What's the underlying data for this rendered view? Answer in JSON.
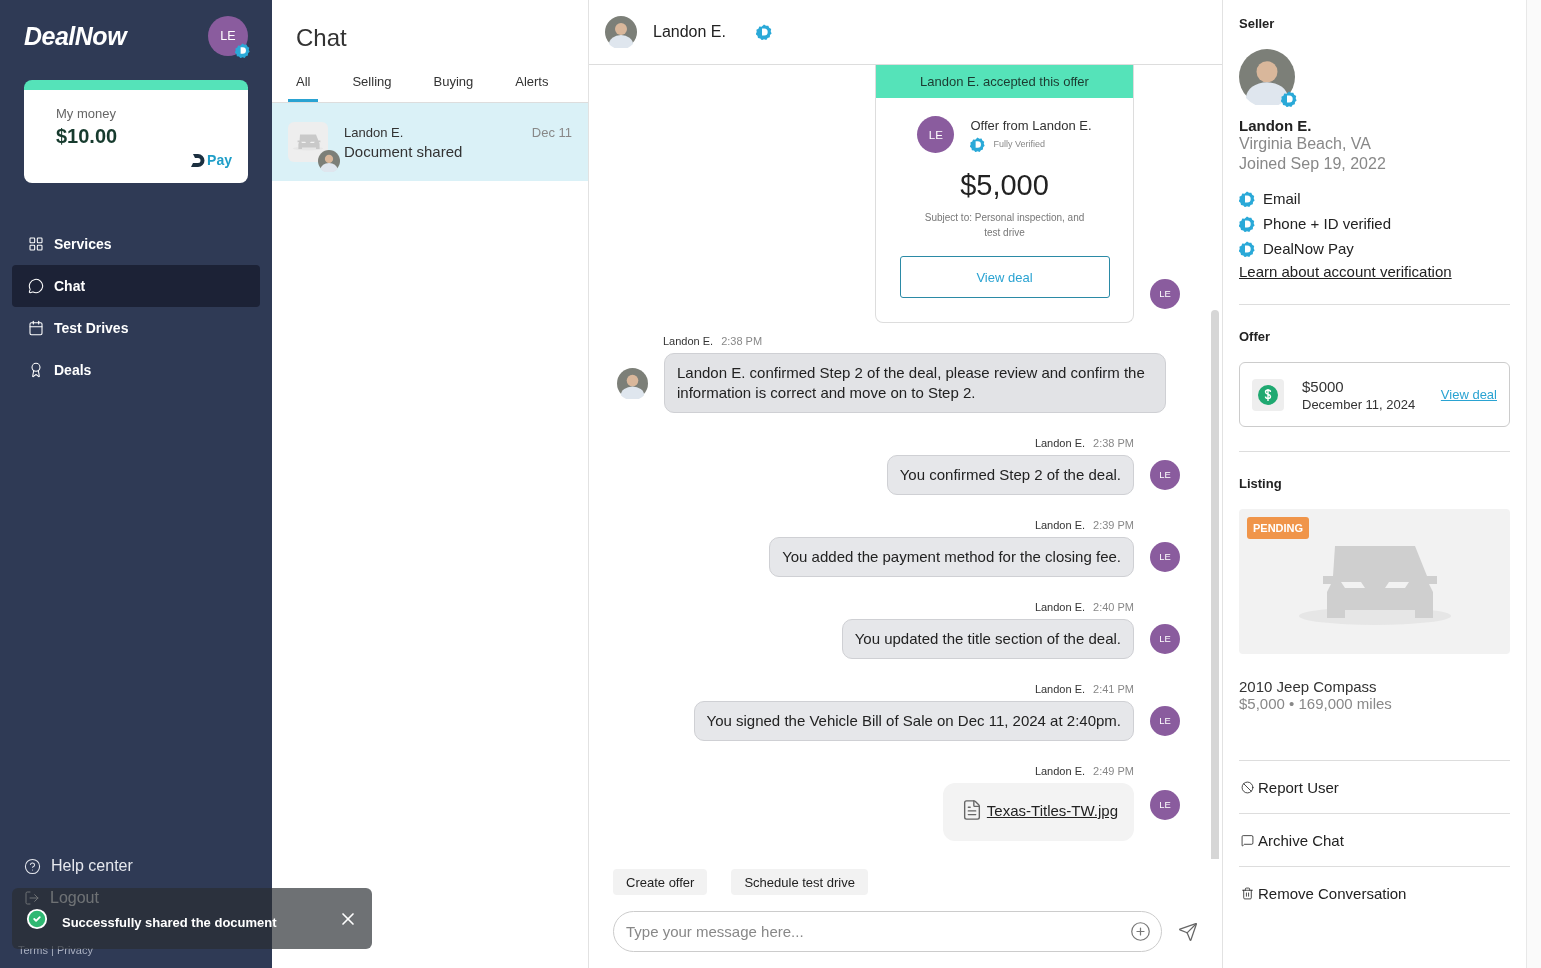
{
  "sidebar": {
    "logo": "DealNow",
    "user_initials": "LE",
    "wallet": {
      "label": "My money",
      "amount": "$10.00",
      "pay_label": "Pay"
    },
    "nav": [
      {
        "label": "Services",
        "selected": false
      },
      {
        "label": "Chat",
        "selected": true
      },
      {
        "label": "Test Drives",
        "selected": false
      },
      {
        "label": "Deals",
        "selected": false
      }
    ],
    "footer": {
      "help": "Help center",
      "logout": "Logout",
      "links": "Terms | Privacy"
    }
  },
  "chat_list": {
    "title": "Chat",
    "tabs": [
      {
        "label": "All",
        "selected": true
      },
      {
        "label": "Selling",
        "selected": false
      },
      {
        "label": "Buying",
        "selected": false
      },
      {
        "label": "Alerts",
        "selected": false
      }
    ],
    "conversations": [
      {
        "name": "Landon E.",
        "preview": "Document shared",
        "date": "Dec 11",
        "selected": true
      }
    ]
  },
  "conversation": {
    "header": {
      "name": "Landon E."
    },
    "messages": [
      {
        "kind": "offer",
        "banner": "Landon E. accepted this offer",
        "initials": "LE",
        "title": "Offer from Landon E.",
        "badge": "Fully Verified",
        "amount": "$5,000",
        "terms": "Subject to: Personal inspection, and test drive",
        "button": "View deal",
        "avatar": "LE"
      },
      {
        "kind": "received",
        "sender": "Landon E.",
        "time": "2:38 PM",
        "text": "Landon E. confirmed Step 2 of the deal, please review and confirm the information is correct and move on to Step 2."
      },
      {
        "kind": "sent",
        "sender": "Landon E.",
        "time": "2:38 PM",
        "text": "You confirmed Step 2 of the deal.",
        "avatar": "LE"
      },
      {
        "kind": "sent",
        "sender": "Landon E.",
        "time": "2:39 PM",
        "text": "You added the payment method for the closing fee.",
        "avatar": "LE"
      },
      {
        "kind": "sent",
        "sender": "Landon E.",
        "time": "2:40 PM",
        "text": "You updated the title section of the deal.",
        "avatar": "LE"
      },
      {
        "kind": "sent",
        "sender": "Landon E.",
        "time": "2:41 PM",
        "text": "You signed the Vehicle Bill of Sale on Dec 11, 2024 at 2:40pm.",
        "avatar": "LE"
      },
      {
        "kind": "file",
        "sender": "Landon E.",
        "time": "2:49 PM",
        "file": "Texas-Titles-TW.jpg",
        "avatar": "LE"
      }
    ],
    "quick_actions": [
      "Create offer",
      "Schedule test drive"
    ],
    "composer": {
      "placeholder": "Type your message here..."
    }
  },
  "details": {
    "seller": {
      "heading": "Seller",
      "name": "Landon E.",
      "location": "Virginia Beach, VA",
      "joined": "Joined Sep 19, 2022",
      "verifications": [
        "Email",
        "Phone + ID verified",
        "DealNow Pay"
      ],
      "learn_link": "Learn about account verification"
    },
    "offer": {
      "heading": "Offer",
      "amount": "$5000",
      "date": "December 11, 2024",
      "link": "View deal"
    },
    "listing": {
      "heading": "Listing",
      "status": "PENDING",
      "title": "2010 Jeep Compass",
      "subtitle": "$5,000 • 169,000 miles"
    },
    "actions": [
      "Report User",
      "Archive Chat",
      "Remove Conversation"
    ]
  },
  "toast": {
    "message": "Successfully shared the document"
  }
}
